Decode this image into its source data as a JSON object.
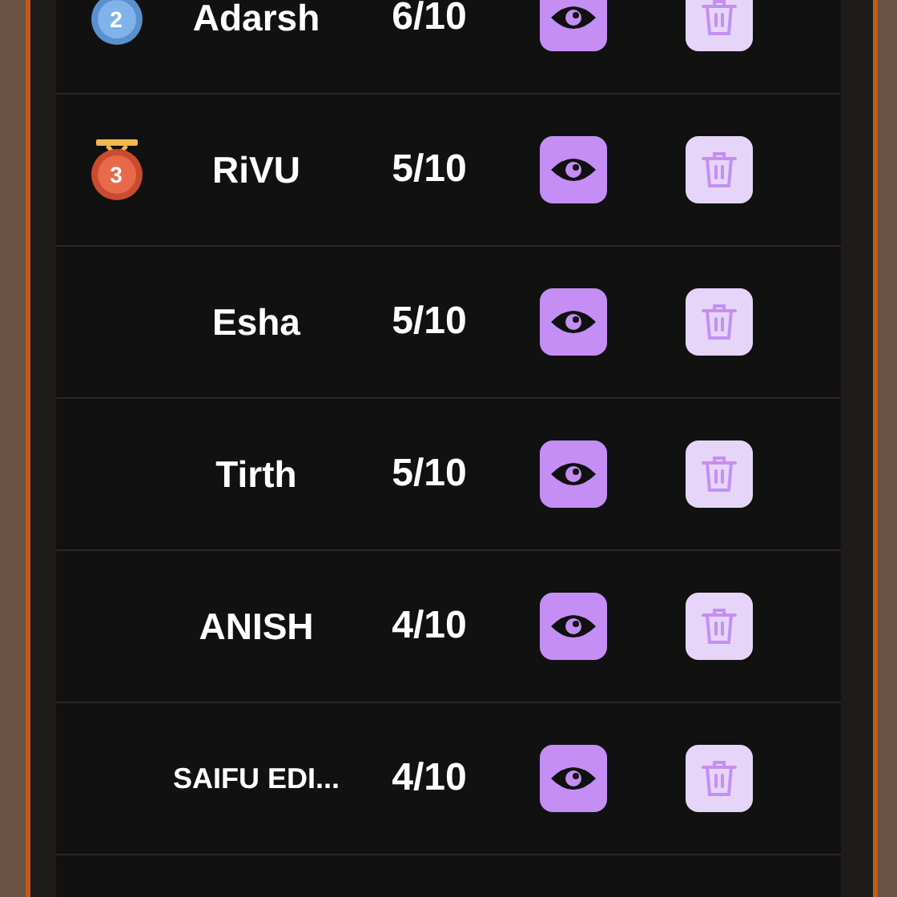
{
  "rows": [
    {
      "medal": {
        "kind": "silver",
        "rank": "2"
      },
      "name": "Adarsh",
      "score": "6/10"
    },
    {
      "medal": {
        "kind": "bronze",
        "rank": "3"
      },
      "name": "RiVU",
      "score": "5/10"
    },
    {
      "name": "Esha",
      "score": "5/10"
    },
    {
      "name": "Tirth",
      "score": "5/10"
    },
    {
      "name": "ANISH",
      "score": "4/10"
    },
    {
      "name": "SAIFU EDI...",
      "score": "4/10"
    }
  ]
}
